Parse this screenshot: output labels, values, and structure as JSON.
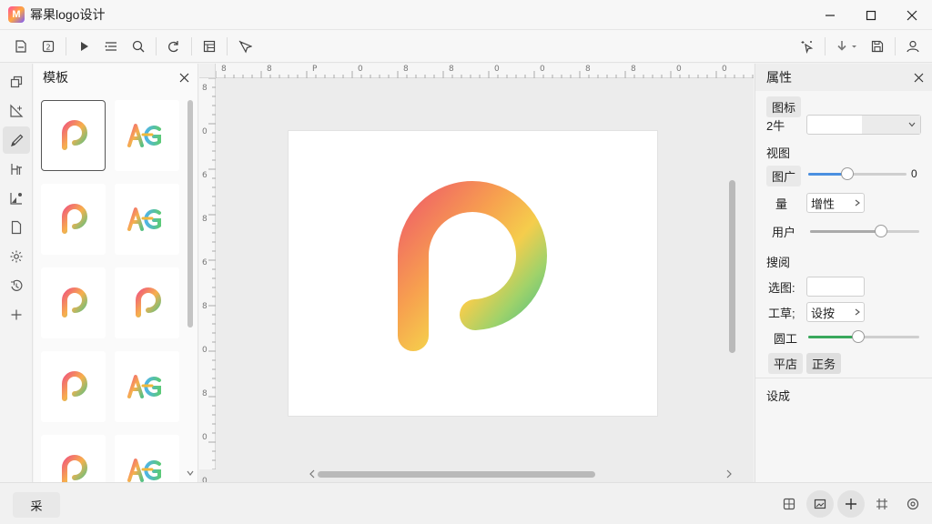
{
  "app": {
    "title": "幂果logo设计",
    "logo_text": "M"
  },
  "toolbar": {
    "left_icons": [
      "open-file-icon",
      "page-number-icon",
      "play-icon",
      "list-icon",
      "search-icon",
      "redo-icon",
      "layout-icon",
      "pointer-icon"
    ],
    "right_icons": [
      "magic-cursor-icon",
      "download-icon",
      "save-icon",
      "account-icon"
    ]
  },
  "rail": {
    "icons": [
      "template-icon",
      "shape-icon",
      "brush-icon",
      "text-icon",
      "chart-icon",
      "document-icon",
      "settings-icon",
      "history-icon",
      "add-icon"
    ],
    "active_index": 2
  },
  "templates": {
    "title": "模板",
    "items": [
      {
        "variant": "p"
      },
      {
        "variant": "letters"
      },
      {
        "variant": "p"
      },
      {
        "variant": "letters"
      },
      {
        "variant": "p"
      },
      {
        "variant": "p"
      },
      {
        "variant": "p"
      },
      {
        "variant": "letters"
      },
      {
        "variant": "p"
      },
      {
        "variant": "letters"
      }
    ],
    "selected_index": 0
  },
  "ruler": {
    "h_marks": [
      "8",
      "8",
      "P",
      "0",
      "8",
      "8",
      "0",
      "0",
      "8",
      "8",
      "0",
      "0"
    ],
    "v_marks": [
      "8",
      "0",
      "6",
      "8",
      "6",
      "8",
      "0",
      "8",
      "0",
      "0"
    ]
  },
  "properties": {
    "title": "属性",
    "section1_label": "图标",
    "size_label": "2牛",
    "section2_label": "视图",
    "opacity_label": "图广",
    "opacity_value": "0",
    "opacity_fraction": 0.4,
    "blend_label": "量",
    "blend_value": "增性",
    "spacing_label": "用户",
    "spacing_fraction": 0.65,
    "section3_label": "搜阅",
    "select_label": "选图:",
    "tool_label": "工草;",
    "tool_value": "设按",
    "round_label": "圆工",
    "round_fraction": 0.45,
    "chip_a": "平店",
    "chip_b": "正务",
    "section4_label": "设成"
  },
  "colors": {
    "accent_blue": "#4a8fe0",
    "accent_green": "#39a85c"
  },
  "status": {
    "left_button": "采",
    "right_icons": [
      "resize-icon",
      "image-icon",
      "add-icon",
      "grid-icon",
      "location-icon"
    ]
  }
}
